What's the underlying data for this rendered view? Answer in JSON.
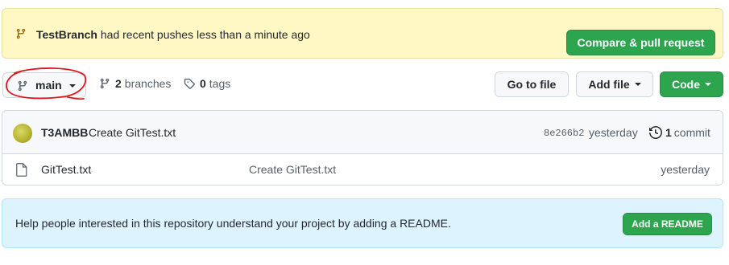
{
  "banner": {
    "branch_name": "TestBranch",
    "message": " had recent pushes less than a minute ago",
    "compare_button": "Compare & pull request",
    "icon": "git-branch-icon"
  },
  "toolbar": {
    "branch_label": "main",
    "branches_count": "2",
    "branches_label": "branches",
    "tags_count": "0",
    "tags_label": "tags",
    "go_to_file": "Go to file",
    "add_file": "Add file",
    "code": "Code"
  },
  "commit": {
    "author": "T3AMBB",
    "message": "Create GitTest.txt",
    "sha": "8e266b2",
    "when": "yesterday",
    "count": "1",
    "count_label": "commit"
  },
  "files": [
    {
      "name": "GitTest.txt",
      "message": "Create GitTest.txt",
      "when": "yesterday"
    }
  ],
  "readme": {
    "message": "Help people interested in this repository understand your project by adding a README.",
    "button": "Add a README"
  },
  "colors": {
    "green": "#2da44e",
    "banner_bg": "#fff8c5",
    "readme_bg": "#ddf4ff",
    "annotation_red": "#e0161f"
  }
}
